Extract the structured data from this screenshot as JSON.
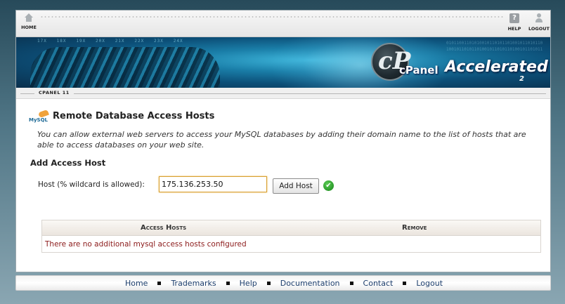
{
  "toolbar": {
    "home_label": "HOME",
    "help_label": "HELP",
    "logout_label": "LOGOUT",
    "help_glyph": "?"
  },
  "banner": {
    "brand_cpanel": "cPanel",
    "brand_accelerated": "Accelerated",
    "brand_version": "2",
    "logo_letter": "cP"
  },
  "strip_label": "CPANEL 11",
  "page": {
    "icon_text": "MySQL",
    "title": "Remote Database Access Hosts",
    "description": "You can allow external web servers to access your MySQL databases by adding their domain name to the list of hosts that are able to access databases on your web site."
  },
  "add_host": {
    "section_title": "Add Access Host",
    "host_label": "Host (% wildcard is allowed):",
    "host_value": "175.136.253.50",
    "button_label": "Add Host",
    "status_icon": "check-icon"
  },
  "table": {
    "headers": [
      "Access Hosts",
      "Remove"
    ],
    "empty_message": "There are no additional mysql access hosts configured"
  },
  "footer": {
    "links": [
      "Home",
      "Trademarks",
      "Help",
      "Documentation",
      "Contact",
      "Logout"
    ]
  }
}
